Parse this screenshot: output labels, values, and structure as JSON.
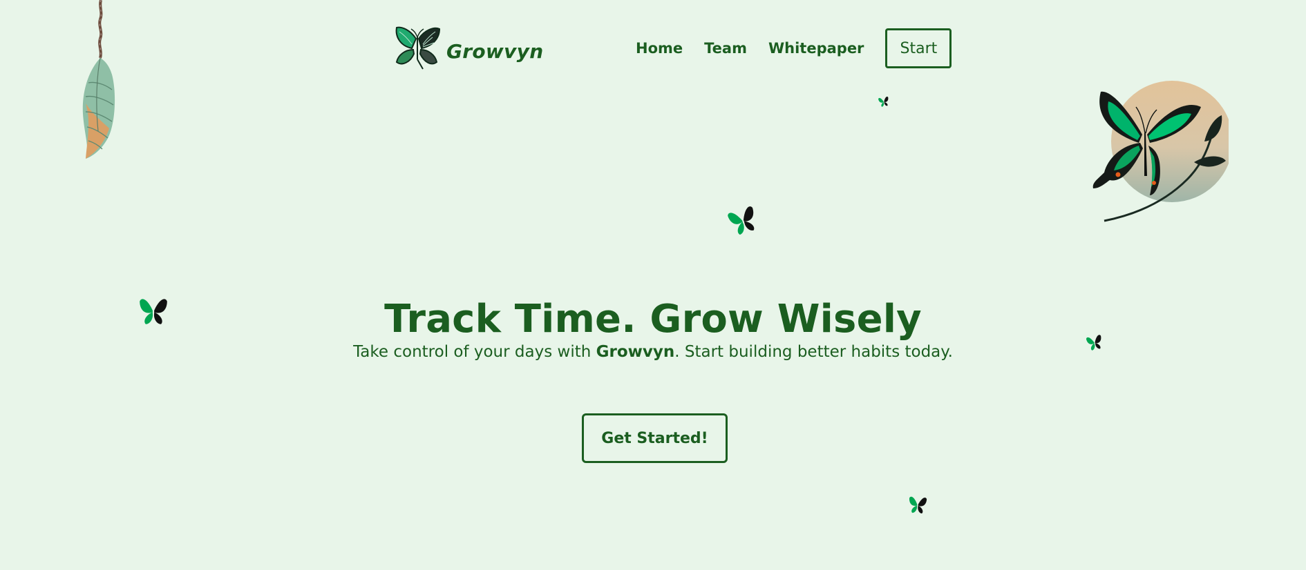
{
  "header": {
    "brand_name": "Growvyn",
    "brand_logo_icon": "butterfly-logo-icon",
    "nav": [
      {
        "label": "Home"
      },
      {
        "label": "Team"
      },
      {
        "label": "Whitepaper"
      }
    ],
    "start_label": "Start"
  },
  "hero": {
    "title": "Track Time. Grow Wisely",
    "subtitle_before": "Take control of your days with ",
    "subtitle_brand": "Growvyn",
    "subtitle_after": ". Start building better habits today.",
    "cta_label": "Get Started!"
  },
  "decorations": {
    "chrysalis_icon": "chrysalis-icon",
    "hero_art_icon": "butterfly-moon-illustration-icon",
    "floating_butterfly_icon": "butterfly-icon"
  },
  "colors": {
    "background": "#e8f5e9",
    "primary": "#1b5e20",
    "butterfly_green": "#00a651",
    "butterfly_black": "#111111",
    "moon": "#e2c39a"
  }
}
